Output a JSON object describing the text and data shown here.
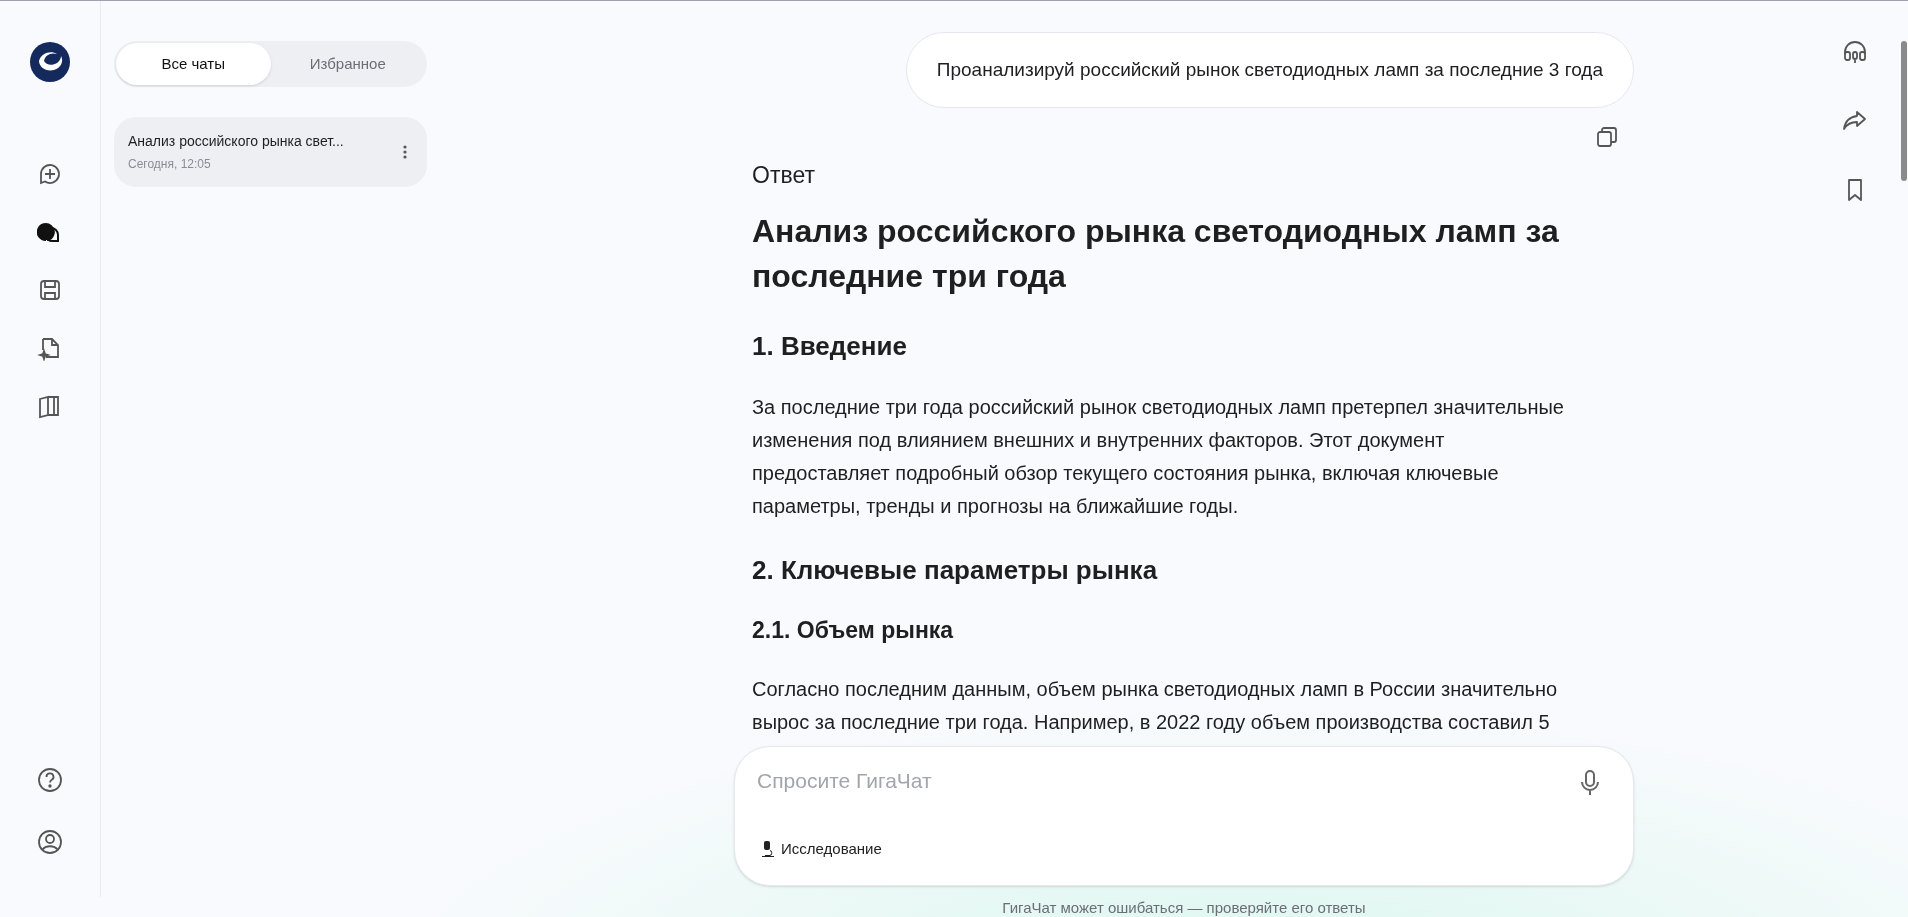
{
  "rail": {
    "top_items": [
      {
        "kind": "new-chat",
        "selected": false
      },
      {
        "kind": "chats",
        "selected": true
      },
      {
        "kind": "saved",
        "selected": false
      },
      {
        "kind": "files",
        "selected": false
      },
      {
        "kind": "book",
        "selected": false
      }
    ],
    "bottom_items": [
      {
        "kind": "help"
      },
      {
        "kind": "profile"
      }
    ]
  },
  "chat_panel": {
    "tabs": [
      {
        "label": "Все чаты",
        "selected": true
      },
      {
        "label": "Избранное",
        "selected": false
      }
    ],
    "chats": [
      {
        "title": "Анализ российского рынка свет...",
        "time": "Сегодня, 12:05",
        "selected": true
      }
    ]
  },
  "conversation": {
    "user_message": "Проанализируй российский рынок светодиодных ламп за последние 3 года",
    "answer_label": "Ответ",
    "blocks": [
      {
        "kind": "h1",
        "text": "Анализ российского рынка светодиодных ламп за последние три года"
      },
      {
        "kind": "h2",
        "text": "1. Введение"
      },
      {
        "kind": "p",
        "text": "За последние три года российский рынок светодиодных ламп претерпел значительные изменения под влиянием внешних и внутренних факторов. Этот документ предоставляет подробный обзор текущего состояния рынка, включая ключевые параметры, тренды и прогнозы на ближайшие годы."
      },
      {
        "kind": "h2",
        "text": "2. Ключевые параметры рынка"
      },
      {
        "kind": "h3",
        "text": "2.1. Объем рынка"
      },
      {
        "kind": "p",
        "text": "Согласно последним данным, объем рынка светодиодных ламп в России значительно вырос за последние три года. Например, в 2022 году объем производства составил 5"
      }
    ]
  },
  "composer": {
    "placeholder": "Спросите ГигаЧат",
    "mode_button": "Исследование"
  },
  "disclaimer": "ГигаЧат может ошибаться — проверяйте его ответы"
}
